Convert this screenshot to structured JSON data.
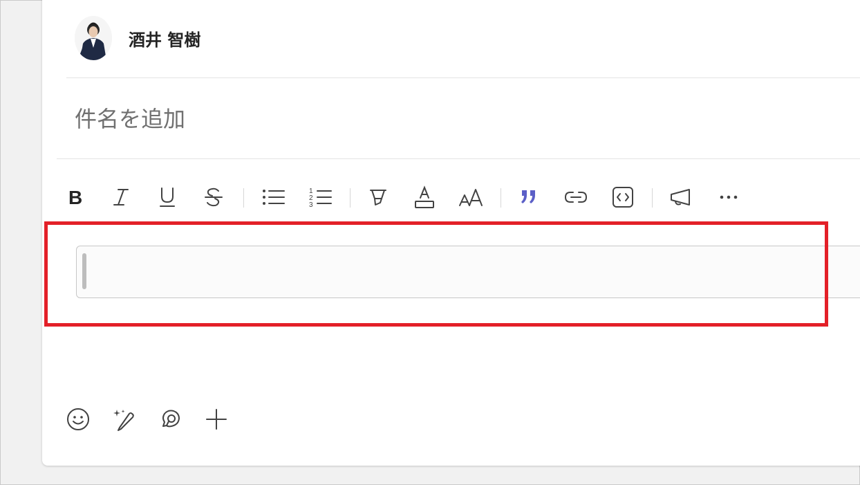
{
  "sender": {
    "name": "酒井 智樹",
    "avatar_icon": "person-avatar"
  },
  "subject": {
    "placeholder": "件名を追加",
    "value": ""
  },
  "toolbar": {
    "bold_icon": "bold-icon",
    "italic_icon": "italic-icon",
    "underline_icon": "underline-icon",
    "strikethrough_icon": "strikethrough-icon",
    "bulleted_list_icon": "bulleted-list-icon",
    "numbered_list_icon": "numbered-list-icon",
    "highlight_icon": "highlight-icon",
    "font_color_icon": "font-color-icon",
    "font_size_icon": "font-size-icon",
    "quote_icon": "quote-icon",
    "link_icon": "link-icon",
    "code_icon": "code-icon",
    "announcement_icon": "announcement-icon",
    "more_icon": "more-icon"
  },
  "editor": {
    "value": ""
  },
  "bottom_toolbar": {
    "emoji_icon": "emoji-icon",
    "copilot_icon": "copilot-pen-icon",
    "loop_icon": "loop-icon",
    "add_icon": "add-icon"
  },
  "colors": {
    "accent_quote": "#5b5fc7",
    "highlight_box": "#e32028",
    "text": "#242424",
    "placeholder": "#707070"
  }
}
